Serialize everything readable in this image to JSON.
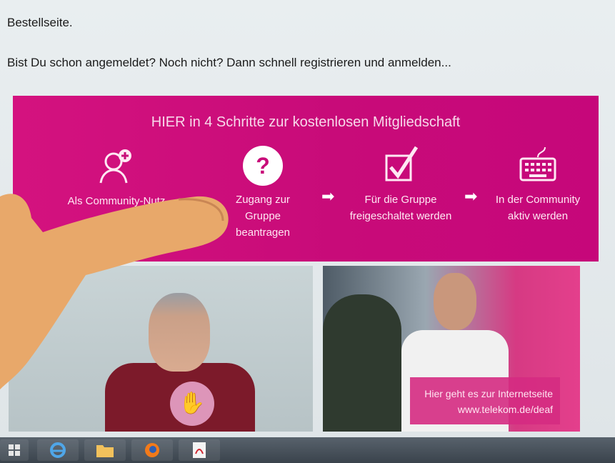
{
  "intro": {
    "line1": "Bestellseite.",
    "line2": "Bist Du schon angemeldet? Noch nicht? Dann schnell registrieren und anmelden..."
  },
  "banner": {
    "title": "HIER in 4 Schritte zur kostenlosen Mitgliedschaft",
    "steps": [
      {
        "icon": "add-user-icon",
        "line1": "Als Community-Nutz",
        "line2": ""
      },
      {
        "icon": "question-icon",
        "line1": "Zugang zur",
        "line2": "Gruppe",
        "line3": "beantragen"
      },
      {
        "icon": "checkbox-icon",
        "line1": "Für die Gruppe",
        "line2": "freigeschaltet werden"
      },
      {
        "icon": "keyboard-icon",
        "line1": "In der Community",
        "line2": "aktiv werden"
      }
    ]
  },
  "promo": {
    "line1": "Hier geht es zur Internetseite",
    "line2": "www.telekom.de/deaf"
  },
  "taskbar": {
    "items": [
      "start-icon",
      "internet-explorer-icon",
      "folder-icon",
      "firefox-icon",
      "pdf-icon"
    ]
  },
  "colors": {
    "magenta": "#d4127f",
    "screen": "#e9eef0",
    "taskbar": "#3a434c"
  }
}
